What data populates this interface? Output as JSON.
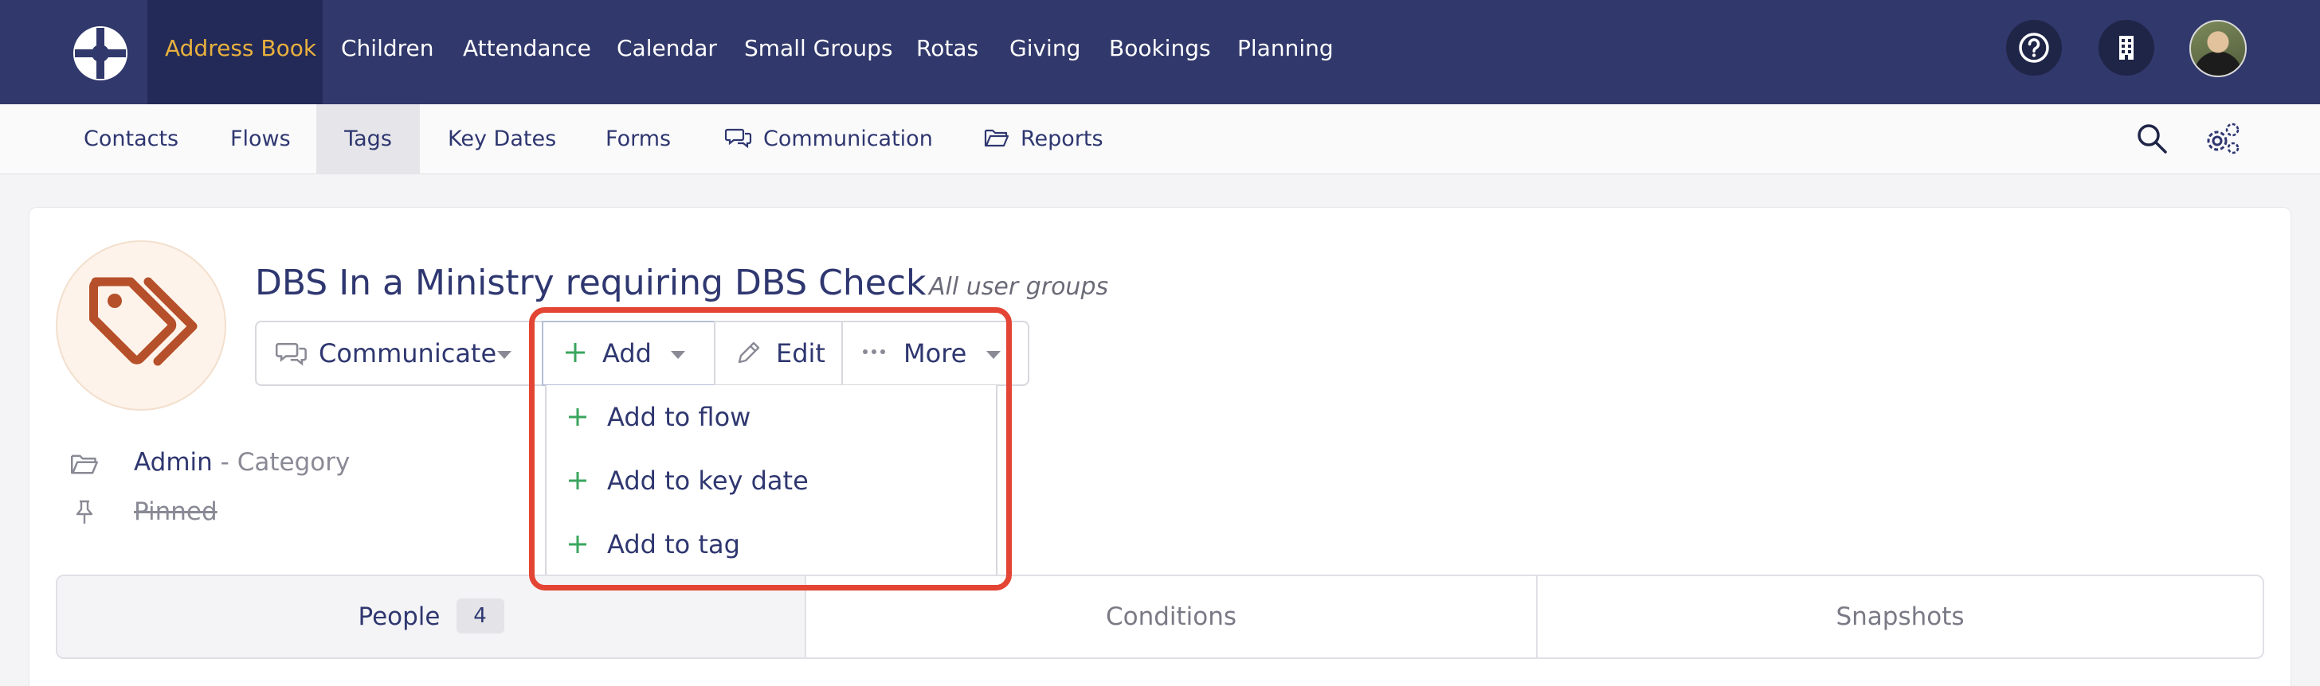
{
  "topnav": {
    "items": [
      {
        "label": "Address Book",
        "active": true
      },
      {
        "label": "Children"
      },
      {
        "label": "Attendance"
      },
      {
        "label": "Calendar"
      },
      {
        "label": "Small Groups"
      },
      {
        "label": "Rotas"
      },
      {
        "label": "Giving"
      },
      {
        "label": "Bookings"
      },
      {
        "label": "Planning"
      }
    ],
    "icons": [
      "help-icon",
      "building-icon",
      "avatar"
    ]
  },
  "subnav": {
    "items": [
      {
        "label": "Contacts"
      },
      {
        "label": "Flows"
      },
      {
        "label": "Tags",
        "active": true
      },
      {
        "label": "Key Dates"
      },
      {
        "label": "Forms"
      },
      {
        "label": "Communication",
        "icon": "chat-icon"
      },
      {
        "label": "Reports",
        "icon": "folder-icon"
      }
    ],
    "icons": [
      "search-icon",
      "settings-icon"
    ]
  },
  "tag": {
    "title": "DBS In a Ministry requiring DBS Check",
    "visibility": "All user groups",
    "category_name": "Admin",
    "category_suffix": "- Category",
    "pinned_label": "Pinned"
  },
  "actions": {
    "communicate": "Communicate",
    "add": "Add",
    "edit": "Edit",
    "more": "More"
  },
  "dropdown": {
    "items": [
      "Add to flow",
      "Add to key date",
      "Add to tag"
    ]
  },
  "tabs": {
    "people": "People",
    "people_count": "4",
    "conditions": "Conditions",
    "snapshots": "Snapshots"
  },
  "colors": {
    "topbar": "#31386b",
    "active_nav": "#e9b13d",
    "accent_green": "#3aa55d",
    "tag_orange": "#b5502a",
    "highlight": "#e34433"
  }
}
